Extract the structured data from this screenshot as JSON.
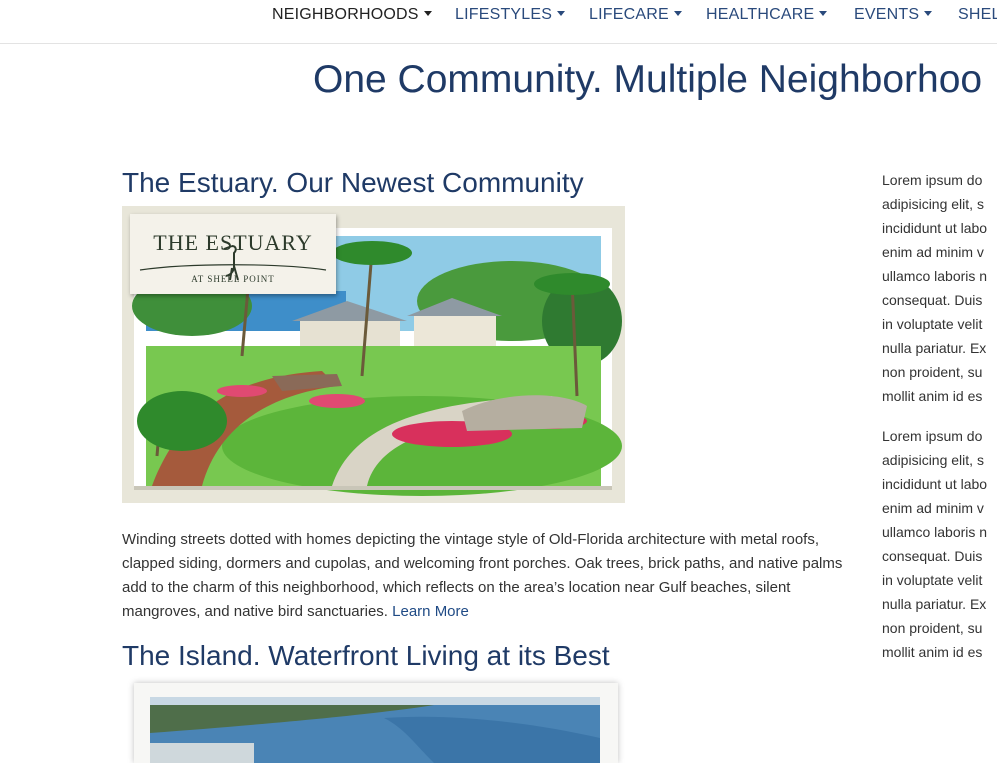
{
  "nav": {
    "items": [
      {
        "label": "NEIGHBORHOODS",
        "active": true
      },
      {
        "label": "LIFESTYLES",
        "active": false
      },
      {
        "label": "LIFECARE",
        "active": false
      },
      {
        "label": "HEALTHCARE",
        "active": false
      },
      {
        "label": "EVENTS",
        "active": false
      },
      {
        "label": "SHEL",
        "active": false
      }
    ]
  },
  "page_title": "One Community. Multiple Neighborhoo",
  "estuary": {
    "title": "The Estuary. Our Newest Community",
    "logo_main": "THE ESTUARY",
    "logo_sub": "AT SHELL POINT",
    "description": "Winding streets dotted with homes depicting the vintage style of Old-Florida architecture with metal roofs, clapped siding, dormers and cupolas, and welcoming front porches. Oak trees, brick paths, and native palms add to the charm of this neighborhood, which reflects on the area’s location near Gulf beaches, silent mangroves, and native bird sanctuaries.",
    "learn_more": "Learn More"
  },
  "island": {
    "title": "The Island. Waterfront Living at its Best"
  },
  "sidebar": {
    "paragraphs": [
      [
        "Lorem ipsum do",
        "adipisicing elit, s",
        "incididunt ut labo",
        "enim ad minim v",
        "ullamco laboris n",
        "consequat. Duis",
        "in voluptate velit",
        "nulla pariatur. Ex",
        "non proident, su",
        "mollit anim id es"
      ],
      [
        "Lorem ipsum do",
        "adipisicing elit, s",
        "incididunt ut labo",
        "enim ad minim v",
        "ullamco laboris n",
        "consequat. Duis",
        "in voluptate velit",
        "nulla pariatur. Ex",
        "non proident, su",
        "mollit anim id es"
      ]
    ]
  },
  "colors": {
    "heading": "#1f3a66",
    "link": "#2a4a7c",
    "body_text": "#333333"
  }
}
